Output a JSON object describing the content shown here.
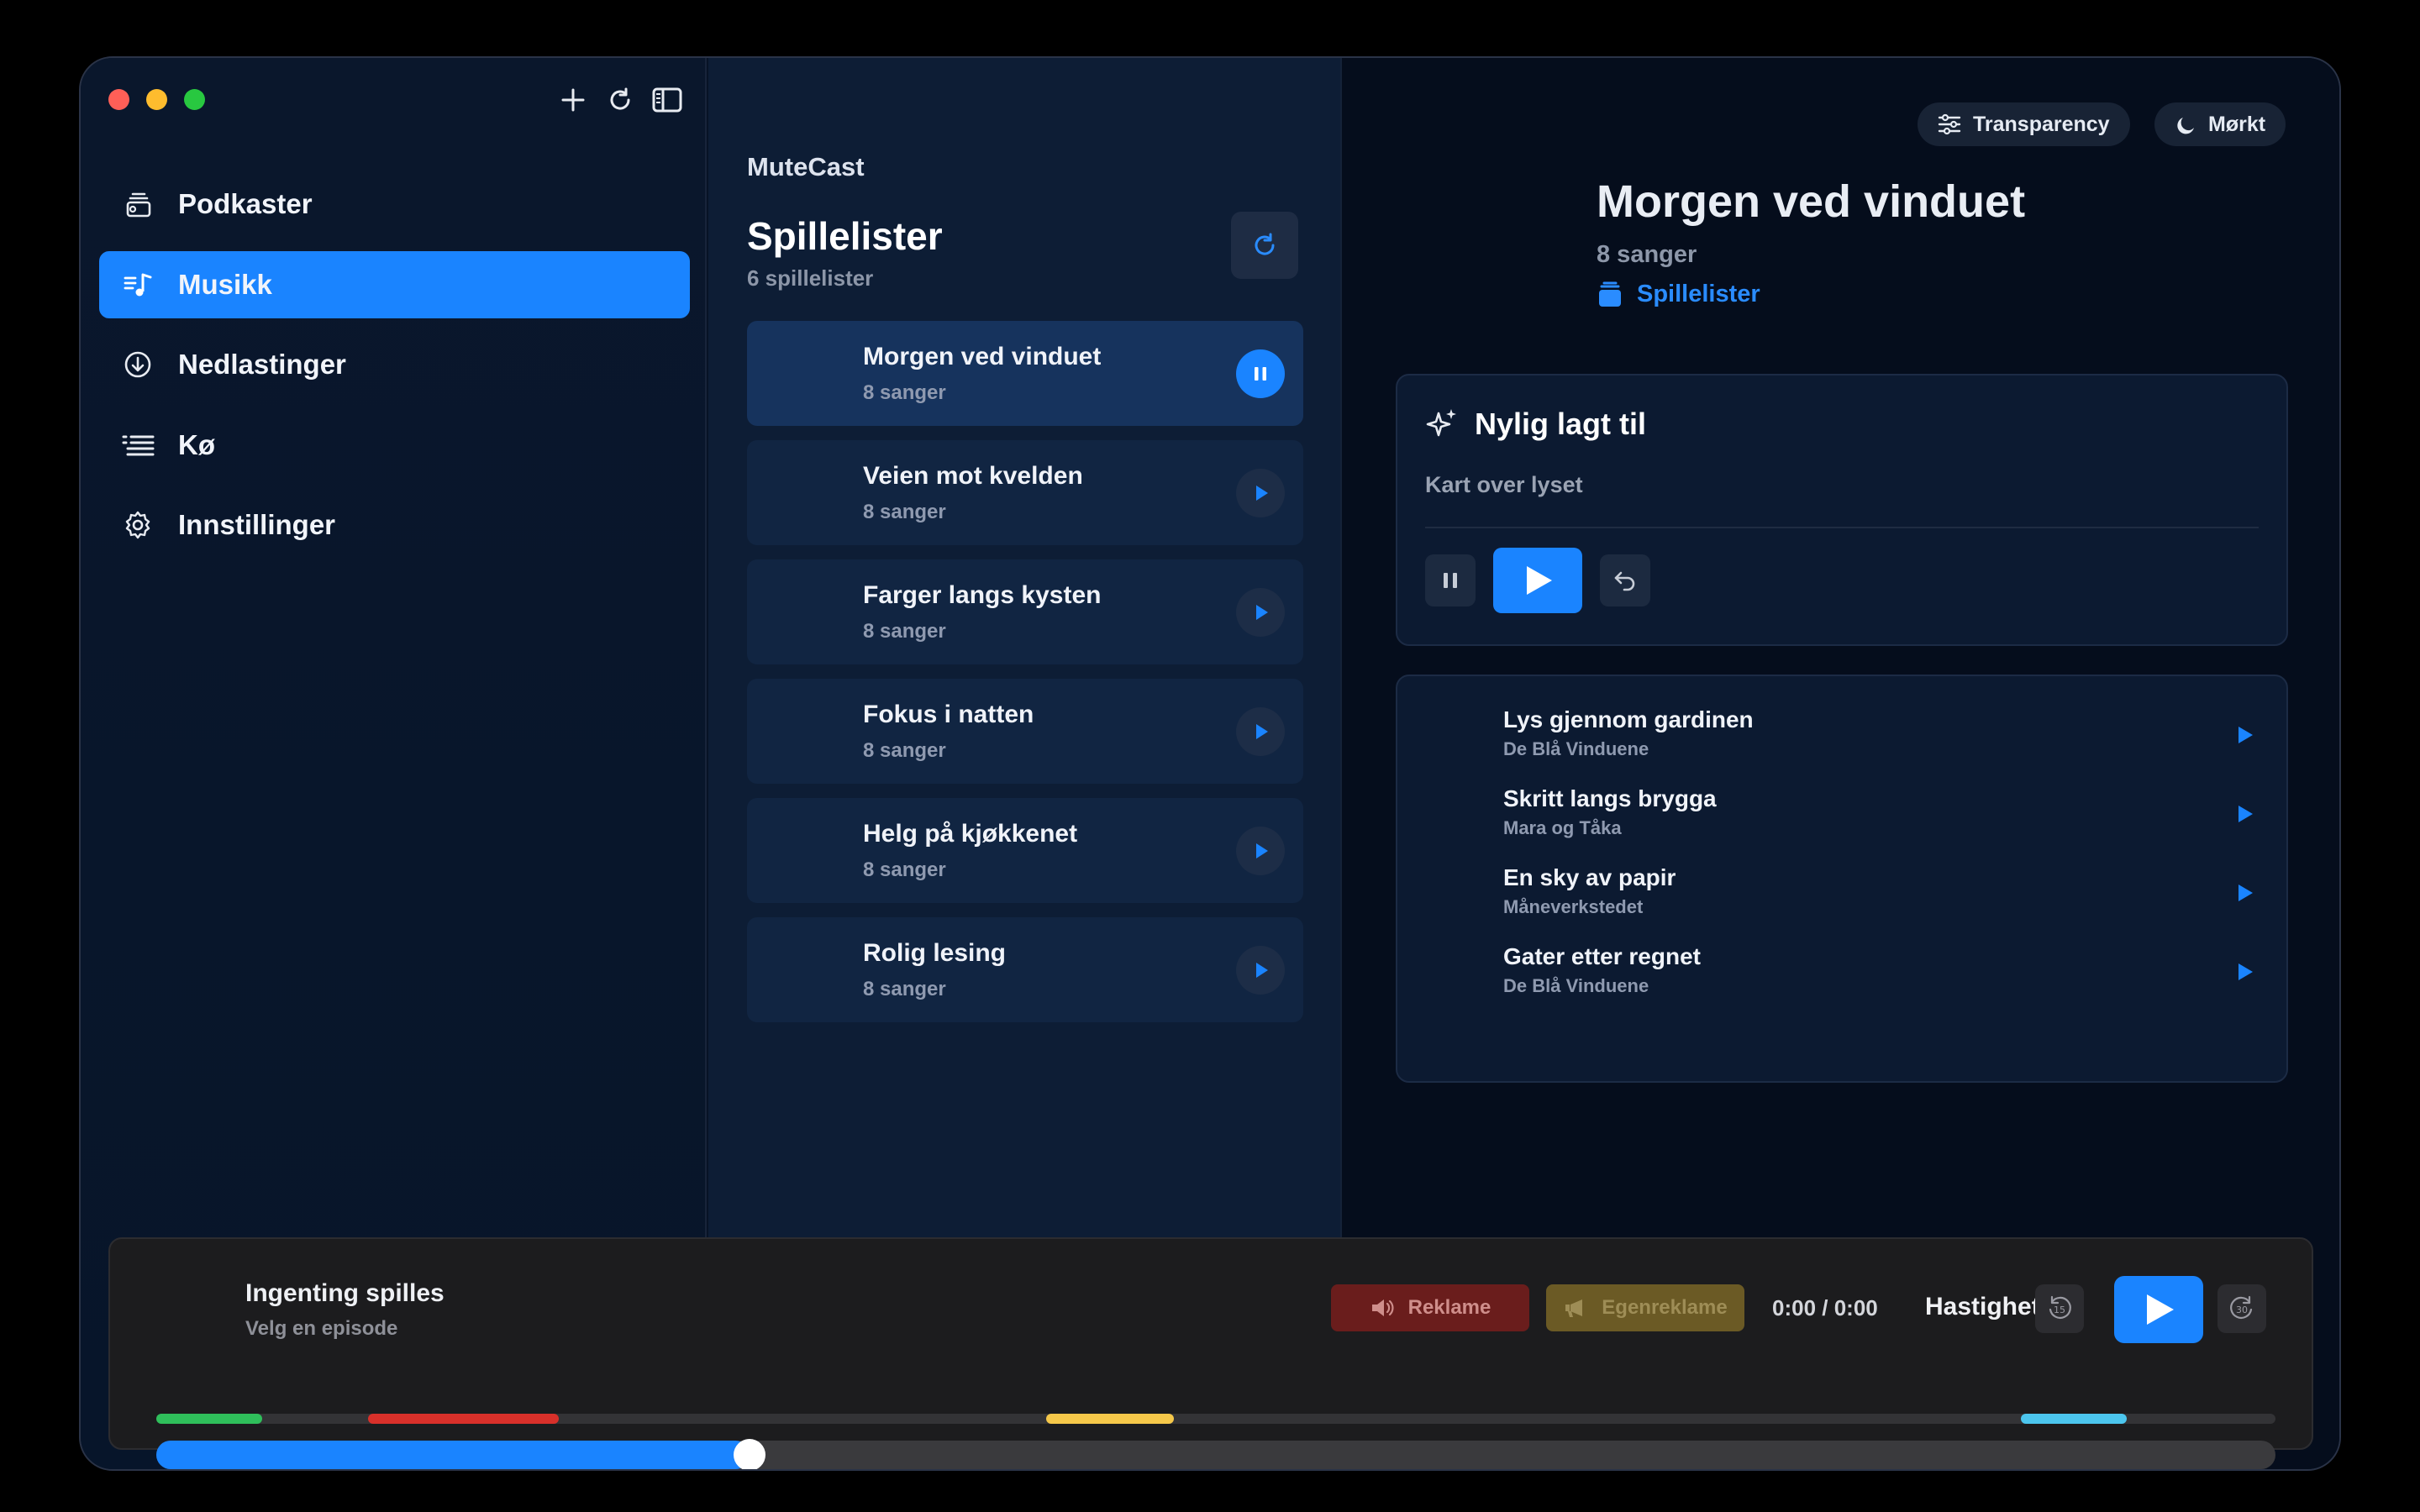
{
  "sidebar": {
    "items": [
      {
        "label": "Podkaster",
        "icon": "podcasts-stack-icon",
        "active": false
      },
      {
        "label": "Musikk",
        "icon": "music-list-icon",
        "active": true
      },
      {
        "label": "Nedlastinger",
        "icon": "download-circle-icon",
        "active": false
      },
      {
        "label": "Kø",
        "icon": "queue-list-icon",
        "active": false
      },
      {
        "label": "Innstillinger",
        "icon": "gear-icon",
        "active": false
      }
    ]
  },
  "middle": {
    "brand": "MuteCast",
    "title": "Spillelister",
    "count": "6 spillelister",
    "playlists": [
      {
        "name": "Morgen ved vinduet",
        "sub": "8 sanger",
        "playing": true
      },
      {
        "name": "Veien mot kvelden",
        "sub": "8 sanger",
        "playing": false
      },
      {
        "name": "Farger langs kysten",
        "sub": "8 sanger",
        "playing": false
      },
      {
        "name": "Fokus i natten",
        "sub": "8 sanger",
        "playing": false
      },
      {
        "name": "Helg på kjøkkenet",
        "sub": "8 sanger",
        "playing": false
      },
      {
        "name": "Rolig lesing",
        "sub": "8 sanger",
        "playing": false
      }
    ]
  },
  "detail": {
    "transparency_label": "Transparency",
    "theme_label": "Mørkt",
    "title": "Morgen ved vinduet",
    "subtitle": "8 sanger",
    "link": "Spillelister",
    "recent": {
      "title": "Nylig lagt til",
      "track": "Kart over lyset"
    },
    "tracks": [
      {
        "name": "Lys gjennom gardinen",
        "artist": "De Blå Vinduene"
      },
      {
        "name": "Skritt langs brygga",
        "artist": "Mara og Tåka"
      },
      {
        "name": "En sky av papir",
        "artist": "Måneverkstedet"
      },
      {
        "name": "Gater etter regnet",
        "artist": "De Blå Vinduene"
      }
    ]
  },
  "player": {
    "title": "Ingenting spilles",
    "subtitle": "Velg en episode",
    "ad_label": "Reklame",
    "self_ad_label": "Egenreklame",
    "time": "0:00 / 0:00",
    "speed_label": "Hastighet",
    "progress_fraction": 0.28,
    "segments": [
      {
        "start": 0.0,
        "end": 0.05,
        "color": "#2fbf5b"
      },
      {
        "start": 0.1,
        "end": 0.19,
        "color": "#d8302a"
      },
      {
        "start": 0.42,
        "end": 0.48,
        "color": "#f5c84a"
      },
      {
        "start": 0.88,
        "end": 0.93,
        "color": "#4cc6ee"
      }
    ]
  },
  "colors": {
    "accent": "#1a84ff",
    "background": "#071326"
  }
}
